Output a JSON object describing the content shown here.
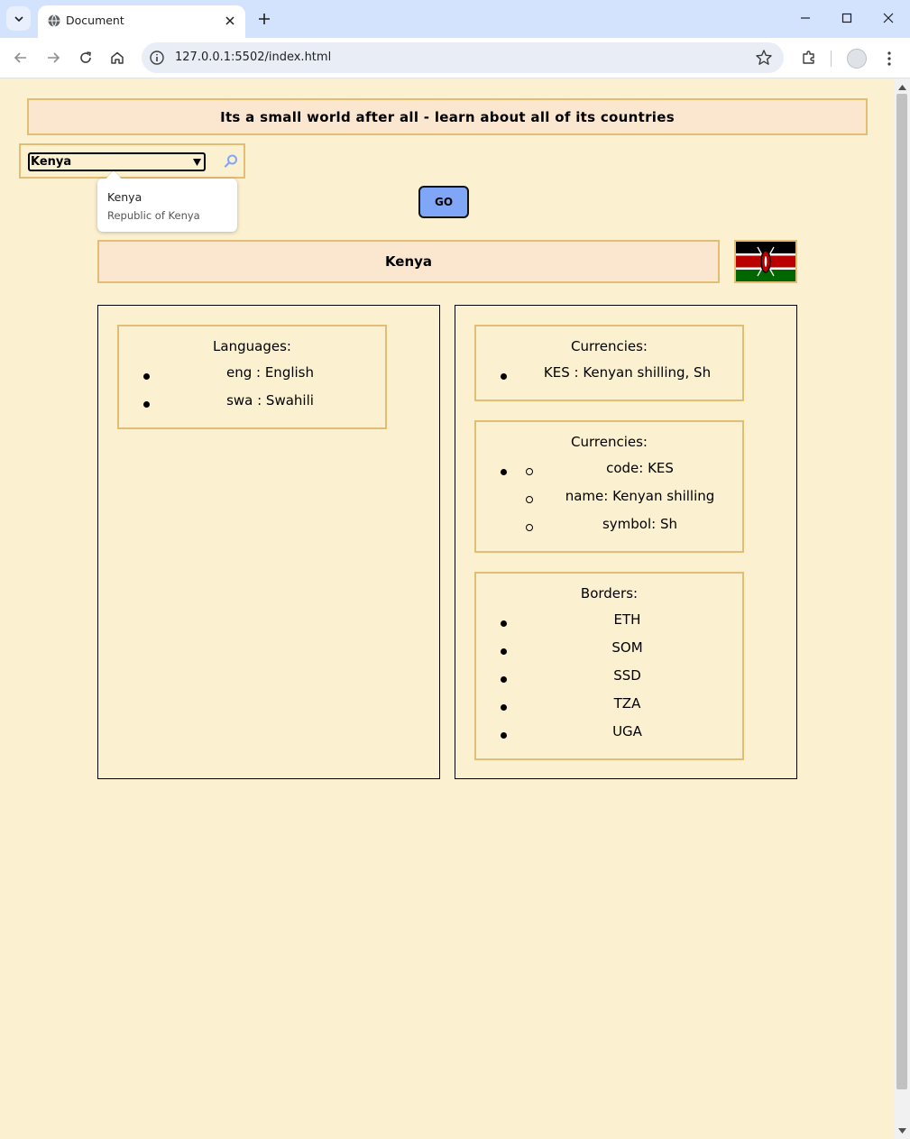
{
  "browser": {
    "tab_title": "Document",
    "url": "127.0.0.1:5502/index.html",
    "icons": [
      "tab-list-icon",
      "globe-icon",
      "close-icon",
      "plus-icon",
      "minimize-icon",
      "maximize-icon",
      "window-close-icon",
      "back-icon",
      "forward-icon",
      "reload-icon",
      "home-icon",
      "site-info-icon",
      "star-icon",
      "extensions-icon",
      "profile-avatar",
      "kebab-menu-icon"
    ]
  },
  "page": {
    "banner": "Its a small world after all - learn about all of its countries",
    "search": {
      "selected": "Kenya",
      "suggestion_name": "Kenya",
      "suggestion_official": "Republic of Kenya"
    },
    "go_label": "GO",
    "country_name": "Kenya",
    "flag": {
      "country": "Kenya",
      "colors": [
        "#000000",
        "#bb0000",
        "#006600",
        "#ffffff"
      ]
    },
    "languages": {
      "title": "Languages:",
      "items": [
        "eng : English",
        "swa : Swahili"
      ]
    },
    "currencies_summary": {
      "title": "Currencies:",
      "items": [
        "KES : Kenyan shilling, Sh"
      ]
    },
    "currencies_detail": {
      "title": "Currencies:",
      "items": [
        "code: KES",
        "name: Kenyan shilling",
        "symbol: Sh"
      ]
    },
    "borders": {
      "title": "Borders:",
      "items": [
        "ETH",
        "SOM",
        "SSD",
        "TZA",
        "UGA"
      ]
    }
  },
  "colors": {
    "page_bg": "#fbf0d0",
    "banner_bg": "#fbe6cf",
    "border_gold": "#e3bd73",
    "go_button": "#7fa6f7"
  }
}
